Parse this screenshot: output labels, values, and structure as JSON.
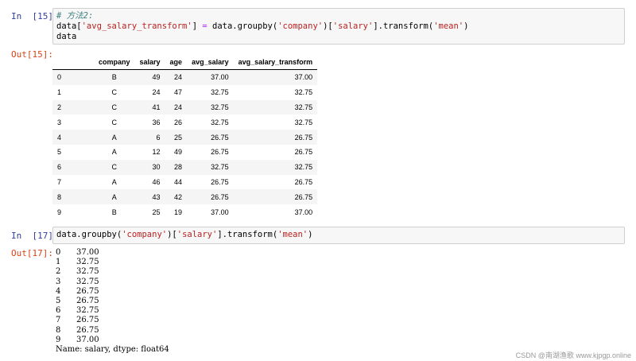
{
  "cell15": {
    "in_prompt": "In  [15]:",
    "out_prompt": "Out[15]:",
    "code_comment": "# 方法2:",
    "code_line2_a": "data[",
    "code_line2_b": "'avg_salary_transform'",
    "code_line2_c": "] ",
    "code_line2_eq": "=",
    "code_line2_d": " data.groupby(",
    "code_line2_e": "'company'",
    "code_line2_f": ")[",
    "code_line2_g": "'salary'",
    "code_line2_h": "].transform(",
    "code_line2_i": "'mean'",
    "code_line2_j": ")",
    "code_line3": "data"
  },
  "table": {
    "columns": [
      "",
      "company",
      "salary",
      "age",
      "avg_salary",
      "avg_salary_transform"
    ],
    "rows": [
      [
        "0",
        "B",
        "49",
        "24",
        "37.00",
        "37.00"
      ],
      [
        "1",
        "C",
        "24",
        "47",
        "32.75",
        "32.75"
      ],
      [
        "2",
        "C",
        "41",
        "24",
        "32.75",
        "32.75"
      ],
      [
        "3",
        "C",
        "36",
        "26",
        "32.75",
        "32.75"
      ],
      [
        "4",
        "A",
        "6",
        "25",
        "26.75",
        "26.75"
      ],
      [
        "5",
        "A",
        "12",
        "49",
        "26.75",
        "26.75"
      ],
      [
        "6",
        "C",
        "30",
        "28",
        "32.75",
        "32.75"
      ],
      [
        "7",
        "A",
        "46",
        "44",
        "26.75",
        "26.75"
      ],
      [
        "8",
        "A",
        "43",
        "42",
        "26.75",
        "26.75"
      ],
      [
        "9",
        "B",
        "25",
        "19",
        "37.00",
        "37.00"
      ]
    ]
  },
  "cell17": {
    "in_prompt": "In  [17]:",
    "out_prompt": "Out[17]:",
    "code_a": "data.groupby(",
    "code_b": "'company'",
    "code_c": ")[",
    "code_d": "'salary'",
    "code_e": "].transform(",
    "code_f": "'mean'",
    "code_g": ")",
    "series": [
      [
        "0",
        "37.00"
      ],
      [
        "1",
        "32.75"
      ],
      [
        "2",
        "32.75"
      ],
      [
        "3",
        "32.75"
      ],
      [
        "4",
        "26.75"
      ],
      [
        "5",
        "26.75"
      ],
      [
        "6",
        "32.75"
      ],
      [
        "7",
        "26.75"
      ],
      [
        "8",
        "26.75"
      ],
      [
        "9",
        "37.00"
      ]
    ],
    "footer": "Name: salary, dtype: float64"
  },
  "watermark": "CSDN @南湖渔歌",
  "watermark_site": "www.kjpgp.online",
  "colors": {
    "in_prompt": "#303f9f",
    "out_prompt": "#d84315",
    "code_bg": "#f7f7f7",
    "string": "#ba2121",
    "comment": "#408080"
  }
}
